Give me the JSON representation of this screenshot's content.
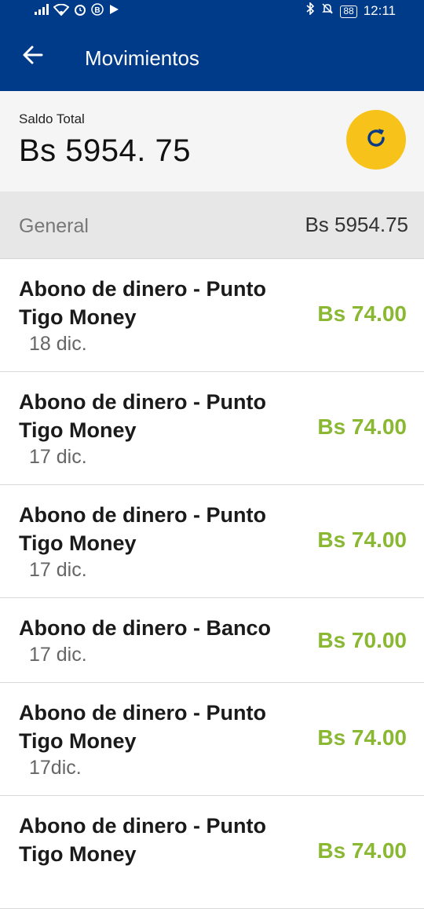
{
  "status_bar": {
    "battery": "88",
    "time": "12:11"
  },
  "app_bar": {
    "title": "Movimientos"
  },
  "balance": {
    "label": "Saldo Total",
    "value": "Bs 5954. 75"
  },
  "general": {
    "label": "General",
    "amount": "Bs 5954.75"
  },
  "transactions": [
    {
      "title": "Abono de dinero - Punto Tigo Money",
      "date": "18 dic.",
      "amount": "Bs 74.00"
    },
    {
      "title": "Abono de dinero - Punto Tigo Money",
      "date": "17 dic.",
      "amount": "Bs 74.00"
    },
    {
      "title": "Abono de dinero - Punto Tigo Money",
      "date": "17 dic.",
      "amount": "Bs 74.00"
    },
    {
      "title": "Abono de dinero - Banco",
      "date": "17 dic.",
      "amount": "Bs 70.00"
    },
    {
      "title": "Abono de dinero - Punto Tigo Money",
      "date": "17dic.",
      "amount": "Bs 74.00"
    },
    {
      "title": "Abono de dinero - Punto Tigo Money",
      "date": "",
      "amount": "Bs 74.00"
    }
  ],
  "colors": {
    "primary": "#003b8a",
    "accent": "#f7c21a",
    "credit": "#8ab833"
  },
  "icons": {
    "back": "arrow-left-icon",
    "refresh": "refresh-icon"
  }
}
